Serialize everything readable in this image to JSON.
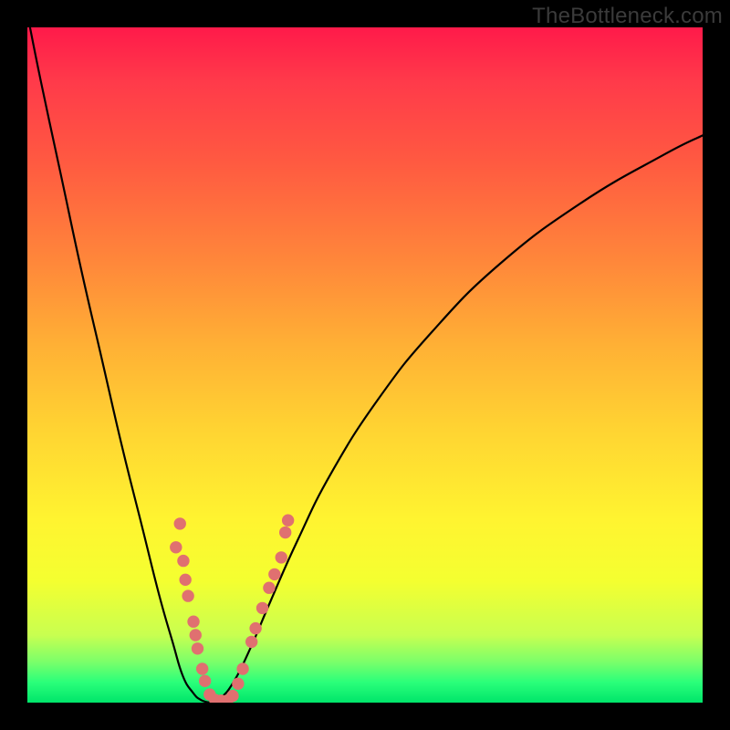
{
  "watermark": "TheBottleneck.com",
  "colors": {
    "frame": "#000000",
    "curve": "#000000",
    "dot": "#e07070",
    "gradient_top": "#ff1a4a",
    "gradient_bottom": "#00e56a"
  },
  "chart_data": {
    "type": "line",
    "title": "",
    "xlabel": "",
    "ylabel": "",
    "xlim": [
      0,
      100
    ],
    "ylim": [
      0,
      100
    ],
    "note": "No axis tick labels are rendered in the image; values are estimated positions in percent of plot area (0,0 = bottom-left, 100,100 = top-right).",
    "series": [
      {
        "name": "left-branch",
        "x": [
          0,
          2,
          5,
          8,
          11,
          14,
          17,
          19.5,
          21.5,
          23,
          24.5,
          25.7,
          27
        ],
        "y": [
          102,
          92,
          78,
          64,
          51,
          38,
          26,
          16,
          9,
          4,
          1.5,
          0.4,
          0
        ]
      },
      {
        "name": "right-branch",
        "x": [
          27,
          28.5,
          30.5,
          33,
          36,
          40,
          45,
          52,
          60,
          70,
          82,
          94,
          100
        ],
        "y": [
          0,
          0.6,
          3,
          8,
          15,
          24,
          34,
          45,
          55,
          65,
          74,
          81,
          84
        ]
      }
    ],
    "dots": [
      {
        "x": 22.6,
        "y": 26.5
      },
      {
        "x": 22.0,
        "y": 23.0
      },
      {
        "x": 23.1,
        "y": 21.0
      },
      {
        "x": 23.4,
        "y": 18.2
      },
      {
        "x": 23.8,
        "y": 15.8
      },
      {
        "x": 24.6,
        "y": 12.0
      },
      {
        "x": 24.9,
        "y": 10.0
      },
      {
        "x": 25.2,
        "y": 8.0
      },
      {
        "x": 25.9,
        "y": 5.0
      },
      {
        "x": 26.3,
        "y": 3.2
      },
      {
        "x": 27.0,
        "y": 1.2
      },
      {
        "x": 27.8,
        "y": 0.4
      },
      {
        "x": 28.7,
        "y": 0.3
      },
      {
        "x": 29.6,
        "y": 0.3
      },
      {
        "x": 30.4,
        "y": 1.0
      },
      {
        "x": 31.2,
        "y": 2.8
      },
      {
        "x": 31.9,
        "y": 5.0
      },
      {
        "x": 33.2,
        "y": 9.0
      },
      {
        "x": 33.8,
        "y": 11.0
      },
      {
        "x": 34.8,
        "y": 14.0
      },
      {
        "x": 35.8,
        "y": 17.0
      },
      {
        "x": 36.6,
        "y": 19.0
      },
      {
        "x": 37.6,
        "y": 21.5
      },
      {
        "x": 38.2,
        "y": 25.2
      },
      {
        "x": 38.6,
        "y": 27.0
      }
    ],
    "dot_radius_px": 6.2
  },
  "interactable_regions": []
}
